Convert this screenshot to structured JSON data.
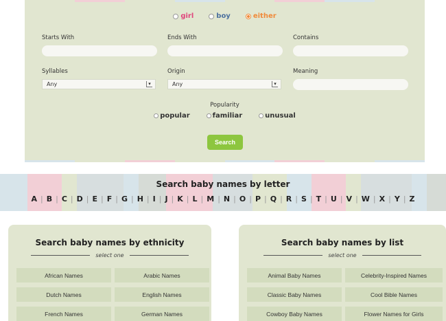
{
  "search": {
    "gender": {
      "options": [
        "girl",
        "boy",
        "either"
      ],
      "selected": "either"
    },
    "fields": {
      "starts_with_label": "Starts With",
      "ends_with_label": "Ends With",
      "contains_label": "Contains",
      "syllables_label": "Syllables",
      "syllables_value": "Any",
      "origin_label": "Origin",
      "origin_value": "Any",
      "meaning_label": "Meaning"
    },
    "popularity": {
      "label": "Popularity",
      "options": [
        "popular",
        "familiar",
        "unusual"
      ]
    },
    "button_label": "Search"
  },
  "letters": {
    "title": "Search baby names by letter",
    "items": [
      "A",
      "B",
      "C",
      "D",
      "E",
      "F",
      "G",
      "H",
      "I",
      "J",
      "K",
      "L",
      "M",
      "N",
      "O",
      "P",
      "Q",
      "R",
      "S",
      "T",
      "U",
      "V",
      "W",
      "X",
      "Y",
      "Z"
    ]
  },
  "ethnicity": {
    "title": "Search baby names by ethnicity",
    "subtitle": "select one",
    "items": [
      "African Names",
      "Arabic Names",
      "Dutch Names",
      "English Names",
      "French Names",
      "German Names"
    ]
  },
  "lists": {
    "title": "Search baby names by list",
    "subtitle": "select one",
    "items": [
      "Animal Baby Names",
      "Celebrity-Inspired Names",
      "Classic Baby Names",
      "Cool Bible Names",
      "Cowboy Baby Names",
      "Flower Names for Girls"
    ]
  },
  "colors": {
    "panel": "#e1e6d0",
    "girl": "#e0457c",
    "boy": "#4a6f9e",
    "either": "#f08a3a",
    "search_button": "#8dc63f",
    "band_pink": "#f2cfd6",
    "band_blue": "#d7e4ea",
    "band_green": "#e1e6d0",
    "band_gray": "#d6dbd6"
  }
}
